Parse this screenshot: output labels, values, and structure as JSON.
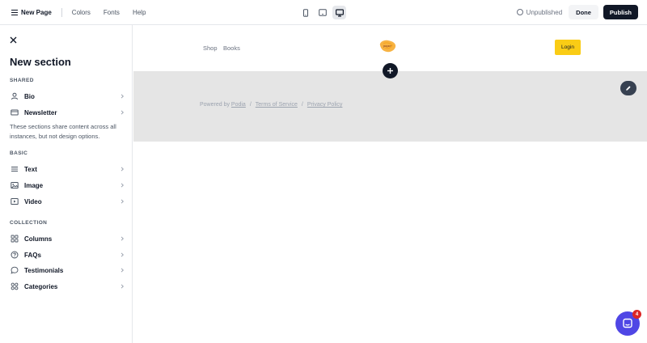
{
  "topbar": {
    "page_name": "New Page",
    "menu": [
      "Colors",
      "Fonts",
      "Help"
    ],
    "status": "Unpublished",
    "done_label": "Done",
    "publish_label": "Publish"
  },
  "sidebar": {
    "title": "New section",
    "groups": {
      "shared": "SHARED",
      "basic": "BASIC",
      "collection": "COLLECTION"
    },
    "shared_items": [
      {
        "label": "Bio",
        "icon": "person-icon"
      },
      {
        "label": "Newsletter",
        "icon": "mail-icon"
      }
    ],
    "shared_note": "These sections share content across all instances, but not design options.",
    "basic_items": [
      {
        "label": "Text",
        "icon": "text-lines-icon"
      },
      {
        "label": "Image",
        "icon": "image-icon"
      },
      {
        "label": "Video",
        "icon": "video-icon"
      }
    ],
    "collection_items": [
      {
        "label": "Columns",
        "icon": "columns-grid-icon"
      },
      {
        "label": "FAQs",
        "icon": "question-circle-icon"
      },
      {
        "label": "Testimonials",
        "icon": "chat-bubble-icon"
      },
      {
        "label": "Categories",
        "icon": "categories-grid-icon"
      }
    ]
  },
  "preview": {
    "nav": [
      "Shop",
      "Books"
    ],
    "logo_text": "paper",
    "login_label": "Login",
    "footer": {
      "powered_by": "Powered by",
      "podia": "Podia",
      "terms": "Terms of Service",
      "privacy": "Privacy Policy",
      "separator": "/"
    }
  },
  "chat": {
    "badge_count": "4"
  },
  "colors": {
    "accent_login": "#facc15",
    "publish_bg": "#111827",
    "chat_bg": "#4f46e5",
    "badge_bg": "#dc2626",
    "footer_band": "#e5e5e5"
  }
}
